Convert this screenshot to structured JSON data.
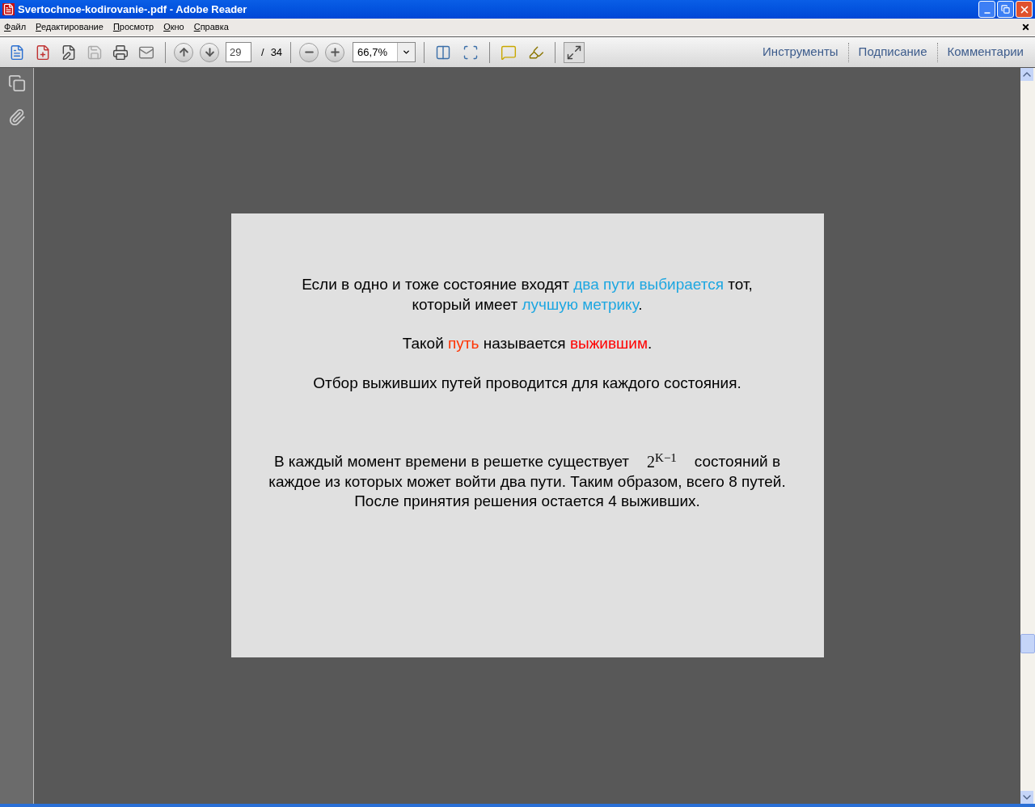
{
  "window": {
    "title": "Svertochnoe-kodirovanie-.pdf - Adobe Reader"
  },
  "menu": [
    "Файл",
    "Редактирование",
    "Просмотр",
    "Окно",
    "Справка"
  ],
  "toolbar": {
    "page": "29",
    "page_separator": "/",
    "page_count": "34",
    "zoom": "66,7%"
  },
  "panels": [
    "Инструменты",
    "Подписание",
    "Комментарии"
  ],
  "document": {
    "paragraphs": [
      {
        "segments": [
          {
            "text": "Если в одно и тоже состояние входят ",
            "kind": "plain"
          },
          {
            "text": "два пути выбирается",
            "kind": "colored",
            "color": "#1ea7e1"
          },
          {
            "text": " тот,",
            "kind": "plain"
          },
          {
            "kind": "break"
          },
          {
            "text": "который имеет ",
            "kind": "plain"
          },
          {
            "text": "лучшую метрику",
            "kind": "colored",
            "color": "#1ea7e1"
          },
          {
            "text": ".",
            "kind": "plain"
          }
        ]
      },
      {
        "segments": [
          {
            "text": "Такой ",
            "kind": "plain"
          },
          {
            "text": "путь",
            "kind": "colored",
            "color": "#ff3300"
          },
          {
            "text": " называется ",
            "kind": "plain"
          },
          {
            "text": "выжившим",
            "kind": "colored",
            "color": "#ff0000"
          },
          {
            "text": ".",
            "kind": "plain"
          }
        ]
      },
      {
        "segments": [
          {
            "text": "Отбор выживших путей проводится для каждого состояния.",
            "kind": "plain"
          }
        ]
      },
      {
        "segments": [
          {
            "text": "В каждый момент времени в решетке существует",
            "kind": "plain"
          },
          {
            "text": "2$^{K−1}$",
            "kind": "formula"
          },
          {
            "text": "состояний в",
            "kind": "plain"
          },
          {
            "kind": "break"
          },
          {
            "text": "каждое из которых может войти два пути. Таким образом, всего 8 путей.",
            "kind": "plain"
          },
          {
            "kind": "break"
          },
          {
            "text": "После принятия решения остается 4 выживших.",
            "kind": "plain"
          }
        ]
      }
    ]
  }
}
